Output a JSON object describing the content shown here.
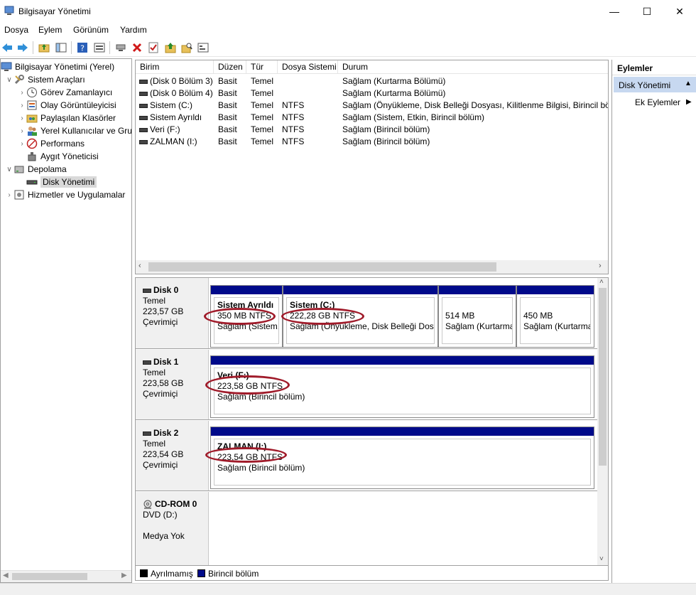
{
  "window": {
    "title": "Bilgisayar Yönetimi",
    "minimize_glyph": "—",
    "maximize_glyph": "☐",
    "close_glyph": "✕"
  },
  "menu": [
    "Dosya",
    "Eylem",
    "Görünüm",
    "Yardım"
  ],
  "toolbar": {
    "icons": [
      "back-icon",
      "forward-icon",
      "up-folder-icon",
      "show-hide-tree-icon",
      "help-icon",
      "properties-view-icon",
      "connect-icon",
      "delete-icon",
      "checklist-icon",
      "folder-up-icon",
      "search-folder-icon",
      "console-icon"
    ]
  },
  "tree": {
    "root": "Bilgisayar Yönetimi (Yerel)",
    "system_tools": "Sistem Araçları",
    "task_scheduler": "Görev Zamanlayıcı",
    "event_viewer": "Olay Görüntüleyicisi",
    "shared_folders": "Paylaşılan Klasörler",
    "local_users": "Yerel Kullanıcılar ve Gru",
    "performance": "Performans",
    "device_manager": "Aygıt Yöneticisi",
    "storage": "Depolama",
    "disk_management": "Disk Yönetimi",
    "services_apps": "Hizmetler ve Uygulamalar"
  },
  "volumes": {
    "columns": [
      "Birim",
      "Düzen",
      "Tür",
      "Dosya Sistemi",
      "Durum"
    ],
    "rows": [
      {
        "name": "(Disk 0 Bölüm 3)",
        "layout": "Basit",
        "type": "Temel",
        "fs": "",
        "status": "Sağlam (Kurtarma Bölümü)"
      },
      {
        "name": "(Disk 0 Bölüm 4)",
        "layout": "Basit",
        "type": "Temel",
        "fs": "",
        "status": "Sağlam (Kurtarma Bölümü)"
      },
      {
        "name": "Sistem (C:)",
        "layout": "Basit",
        "type": "Temel",
        "fs": "NTFS",
        "status": "Sağlam (Önyükleme, Disk Belleği Dosyası, Kilitlenme Bilgisi, Birincil bölü"
      },
      {
        "name": "Sistem Ayrıldı",
        "layout": "Basit",
        "type": "Temel",
        "fs": "NTFS",
        "status": "Sağlam (Sistem, Etkin, Birincil bölüm)"
      },
      {
        "name": "Veri (F:)",
        "layout": "Basit",
        "type": "Temel",
        "fs": "NTFS",
        "status": "Sağlam (Birincil bölüm)"
      },
      {
        "name": "ZALMAN (I:)",
        "layout": "Basit",
        "type": "Temel",
        "fs": "NTFS",
        "status": "Sağlam (Birincil bölüm)"
      }
    ]
  },
  "disks": {
    "disk0": {
      "name": "Disk 0",
      "kind": "Temel",
      "size": "223,57 GB",
      "state": "Çevrimiçi",
      "p1": {
        "name": "Sistem Ayrıldı",
        "size": "350 MB NTFS",
        "status": "Sağlam (Sistem,"
      },
      "p2": {
        "name": "Sistem  (C:)",
        "size": "222,28 GB NTFS",
        "status": "Sağlam (Önyükleme, Disk Belleği Dosy"
      },
      "p3": {
        "size": "514 MB",
        "status": "Sağlam (Kurtarma"
      },
      "p4": {
        "size": "450 MB",
        "status": "Sağlam (Kurtarma"
      }
    },
    "disk1": {
      "name": "Disk 1",
      "kind": "Temel",
      "size": "223,58 GB",
      "state": "Çevrimiçi",
      "p1": {
        "name": "Veri  (F:)",
        "size": "223,58 GB NTFS",
        "status": "Sağlam (Birincil bölüm)"
      }
    },
    "disk2": {
      "name": "Disk 2",
      "kind": "Temel",
      "size": "223,54 GB",
      "state": "Çevrimiçi",
      "p1": {
        "name": "ZALMAN  (I:)",
        "size": "223,54 GB NTFS",
        "status": "Sağlam (Birincil bölüm)"
      }
    },
    "cdrom": {
      "name": "CD-ROM 0",
      "drive": "DVD (D:)",
      "media": "Medya Yok"
    }
  },
  "legend": {
    "unallocated": "Ayrılmamış",
    "primary": "Birincil bölüm",
    "unallocated_color": "#000000",
    "primary_color": "#000a8a"
  },
  "actions": {
    "header": "Eylemler",
    "section": "Disk Yönetimi",
    "more": "Ek Eylemler"
  },
  "colors": {
    "partition_header": "#000a8a",
    "highlight_oval": "#a01b2a",
    "selection": "#c7d8f0"
  }
}
